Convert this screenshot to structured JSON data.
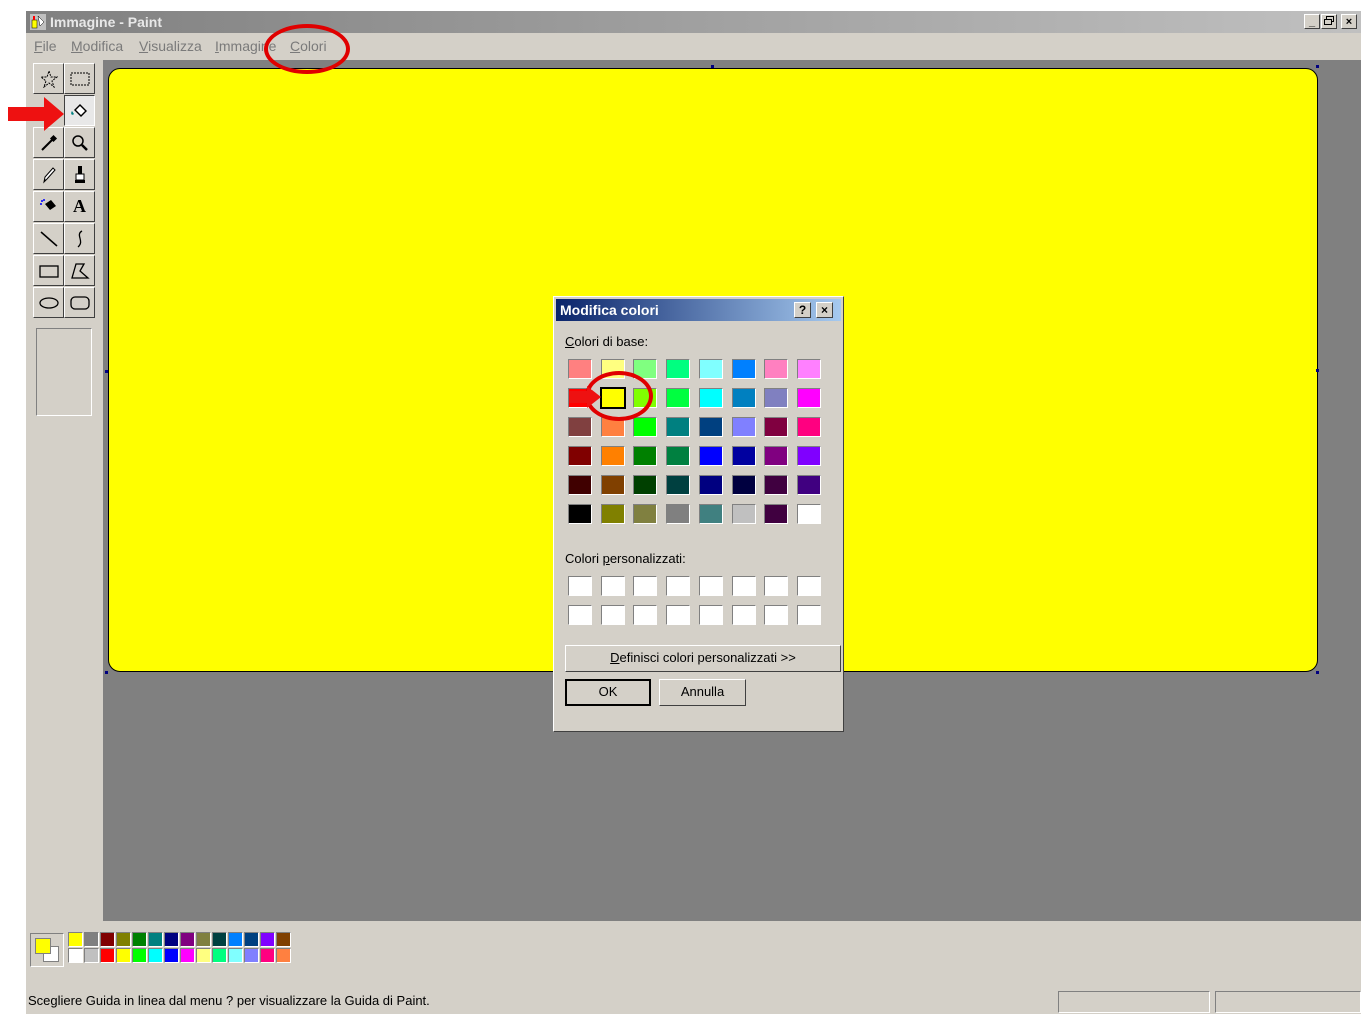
{
  "window": {
    "title": "Immagine - Paint",
    "controls": [
      "_",
      "Ɖ",
      "×"
    ]
  },
  "menu": {
    "items": [
      {
        "pre": "",
        "u": "F",
        "post": "ile"
      },
      {
        "pre": "",
        "u": "M",
        "post": "odifica"
      },
      {
        "pre": "",
        "u": "V",
        "post": "isualizza"
      },
      {
        "pre": "",
        "u": "I",
        "post": "mmagine"
      },
      {
        "pre": "",
        "u": "C",
        "post": "olori"
      }
    ]
  },
  "tools": [
    {
      "name": "free-form-select",
      "glyph": "☆"
    },
    {
      "name": "select",
      "glyph": "▭"
    },
    {
      "name": "fill-with-color",
      "glyph": "◆"
    },
    {
      "name": "eraser",
      "glyph": ""
    },
    {
      "name": "pick-color",
      "glyph": "∕"
    },
    {
      "name": "magnifier",
      "glyph": "⌕"
    },
    {
      "name": "pencil",
      "glyph": "✎"
    },
    {
      "name": "brush",
      "glyph": "♀"
    },
    {
      "name": "airbrush",
      "glyph": "▲"
    },
    {
      "name": "text",
      "glyph": "A"
    },
    {
      "name": "line",
      "glyph": "╲"
    },
    {
      "name": "curve",
      "glyph": "≀"
    },
    {
      "name": "rectangle",
      "glyph": "▭"
    },
    {
      "name": "polygon",
      "glyph": "▱"
    },
    {
      "name": "ellipse",
      "glyph": "⬭"
    },
    {
      "name": "rounded-rectangle",
      "glyph": "▢"
    }
  ],
  "palette": {
    "top": [
      "#ffff00",
      "#808080",
      "#800000",
      "#808000",
      "#008000",
      "#008080",
      "#000080",
      "#800080",
      "#808040",
      "#004040",
      "#0080ff",
      "#004080",
      "#8000ff",
      "#804000"
    ],
    "bottom": [
      "#ffffff",
      "#c0c0c0",
      "#ff0000",
      "#ffff00",
      "#00ff00",
      "#00ffff",
      "#0000ff",
      "#ff00ff",
      "#ffff80",
      "#00ff80",
      "#80ffff",
      "#8080ff",
      "#ff0080",
      "#ff8040"
    ],
    "foreground": "#ffff00",
    "background": "#ffffff"
  },
  "status": {
    "text": "Scegliere Guida in linea dal menu ? per visualizzare la Guida di Paint."
  },
  "dialog": {
    "title": "Modifica colori",
    "help_btn": "?",
    "close_btn": "×",
    "basic_label_u": "C",
    "basic_label_rest": "olori di base:",
    "custom_label_pre": "Colori ",
    "custom_label_u": "p",
    "custom_label_rest": "ersonalizzati:",
    "define_btn_u": "D",
    "define_btn_rest": "efinisci colori personalizzati >>",
    "ok_btn": "OK",
    "cancel_btn": "Annulla",
    "basic_colors": [
      [
        "#ff8080",
        "#ffff80",
        "#80ff80",
        "#00ff80",
        "#80ffff",
        "#0080ff",
        "#ff80c0",
        "#ff80ff"
      ],
      [
        "#ff0000",
        "#ffff00",
        "#80ff00",
        "#00ff40",
        "#00ffff",
        "#0080c0",
        "#8080c0",
        "#ff00ff"
      ],
      [
        "#804040",
        "#ff8040",
        "#00ff00",
        "#008080",
        "#004080",
        "#8080ff",
        "#800040",
        "#ff0080"
      ],
      [
        "#800000",
        "#ff8000",
        "#008000",
        "#008040",
        "#0000ff",
        "#0000a0",
        "#800080",
        "#8000ff"
      ],
      [
        "#400000",
        "#804000",
        "#004000",
        "#004040",
        "#000080",
        "#000040",
        "#400040",
        "#400080"
      ],
      [
        "#000000",
        "#808000",
        "#808040",
        "#808080",
        "#408080",
        "#c0c0c0",
        "#400040",
        "#ffffff"
      ]
    ],
    "selected": [
      1,
      1
    ]
  }
}
